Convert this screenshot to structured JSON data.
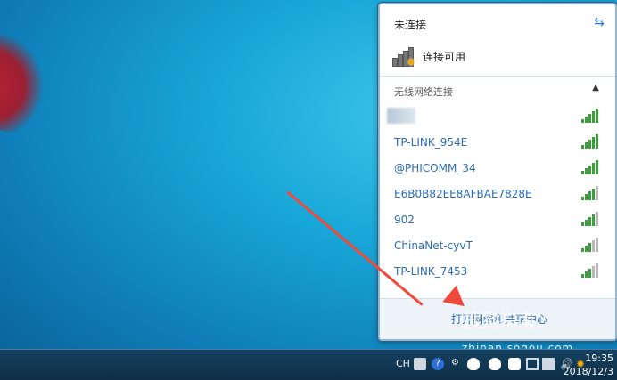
{
  "flyout": {
    "title": "未连接",
    "refresh_icon": "refresh-icon",
    "available": "连接可用",
    "section": "无线网络连接",
    "networks": [
      {
        "name": "",
        "hidden": true,
        "signal": 5
      },
      {
        "name": "TP-LINK_954E",
        "signal": 5
      },
      {
        "name": "@PHICOMM_34",
        "signal": 5
      },
      {
        "name": "E6B0B82EE8AFBAE7828E",
        "signal": 4
      },
      {
        "name": "902",
        "signal": 4
      },
      {
        "name": "ChinaNet-cyvT",
        "signal": 3
      },
      {
        "name": "TP-LINK_7453",
        "signal": 3
      }
    ],
    "open_center": "打开网络和共享中心"
  },
  "watermark": {
    "brand": "搜狗指南",
    "url": "zhinan.sogou.com"
  },
  "taskbar": {
    "lang": "CH",
    "time": "19:35",
    "date": "2018/12/3"
  },
  "colors": {
    "link": "#2b6cb3",
    "signal_on": "#3aa03a",
    "signal_off": "#b9b9b9",
    "arrow": "#f04a3d"
  }
}
